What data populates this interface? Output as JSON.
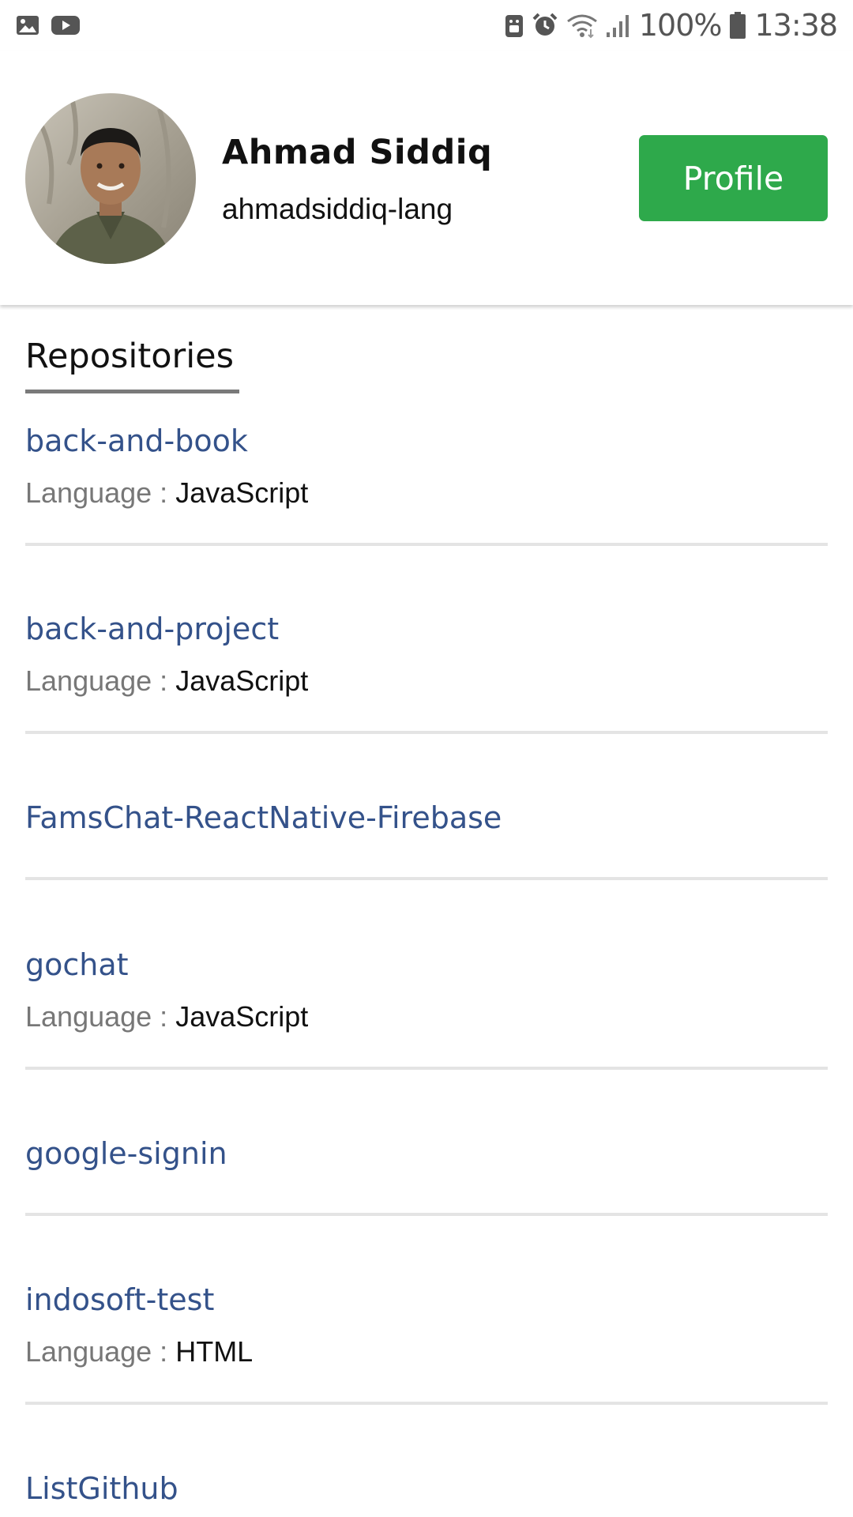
{
  "status_bar": {
    "left_icons": [
      "image-icon",
      "youtube-icon"
    ],
    "right_icons": [
      "android-icon",
      "alarm-icon",
      "wifi-icon",
      "signal-icon",
      "battery-icon"
    ],
    "battery": "100%",
    "time": "13:38"
  },
  "header": {
    "name": "Ahmad Siddiq",
    "username": "ahmadsiddiq-lang",
    "profile_button": "Profile",
    "accent_color": "#2ea94b"
  },
  "repositories": {
    "title": "Repositories",
    "link_color": "#34528a",
    "items": [
      {
        "name": "back-and-book",
        "language_label": "Language :",
        "language": "JavaScript"
      },
      {
        "name": "back-and-project",
        "language_label": "Language :",
        "language": "JavaScript"
      },
      {
        "name": "FamsChat-ReactNative-Firebase",
        "language_label": "",
        "language": ""
      },
      {
        "name": "gochat",
        "language_label": "Language :",
        "language": "JavaScript"
      },
      {
        "name": "google-signin",
        "language_label": "",
        "language": ""
      },
      {
        "name": "indosoft-test",
        "language_label": "Language :",
        "language": "HTML"
      },
      {
        "name": "ListGithub",
        "language_label": "",
        "language": ""
      }
    ]
  }
}
